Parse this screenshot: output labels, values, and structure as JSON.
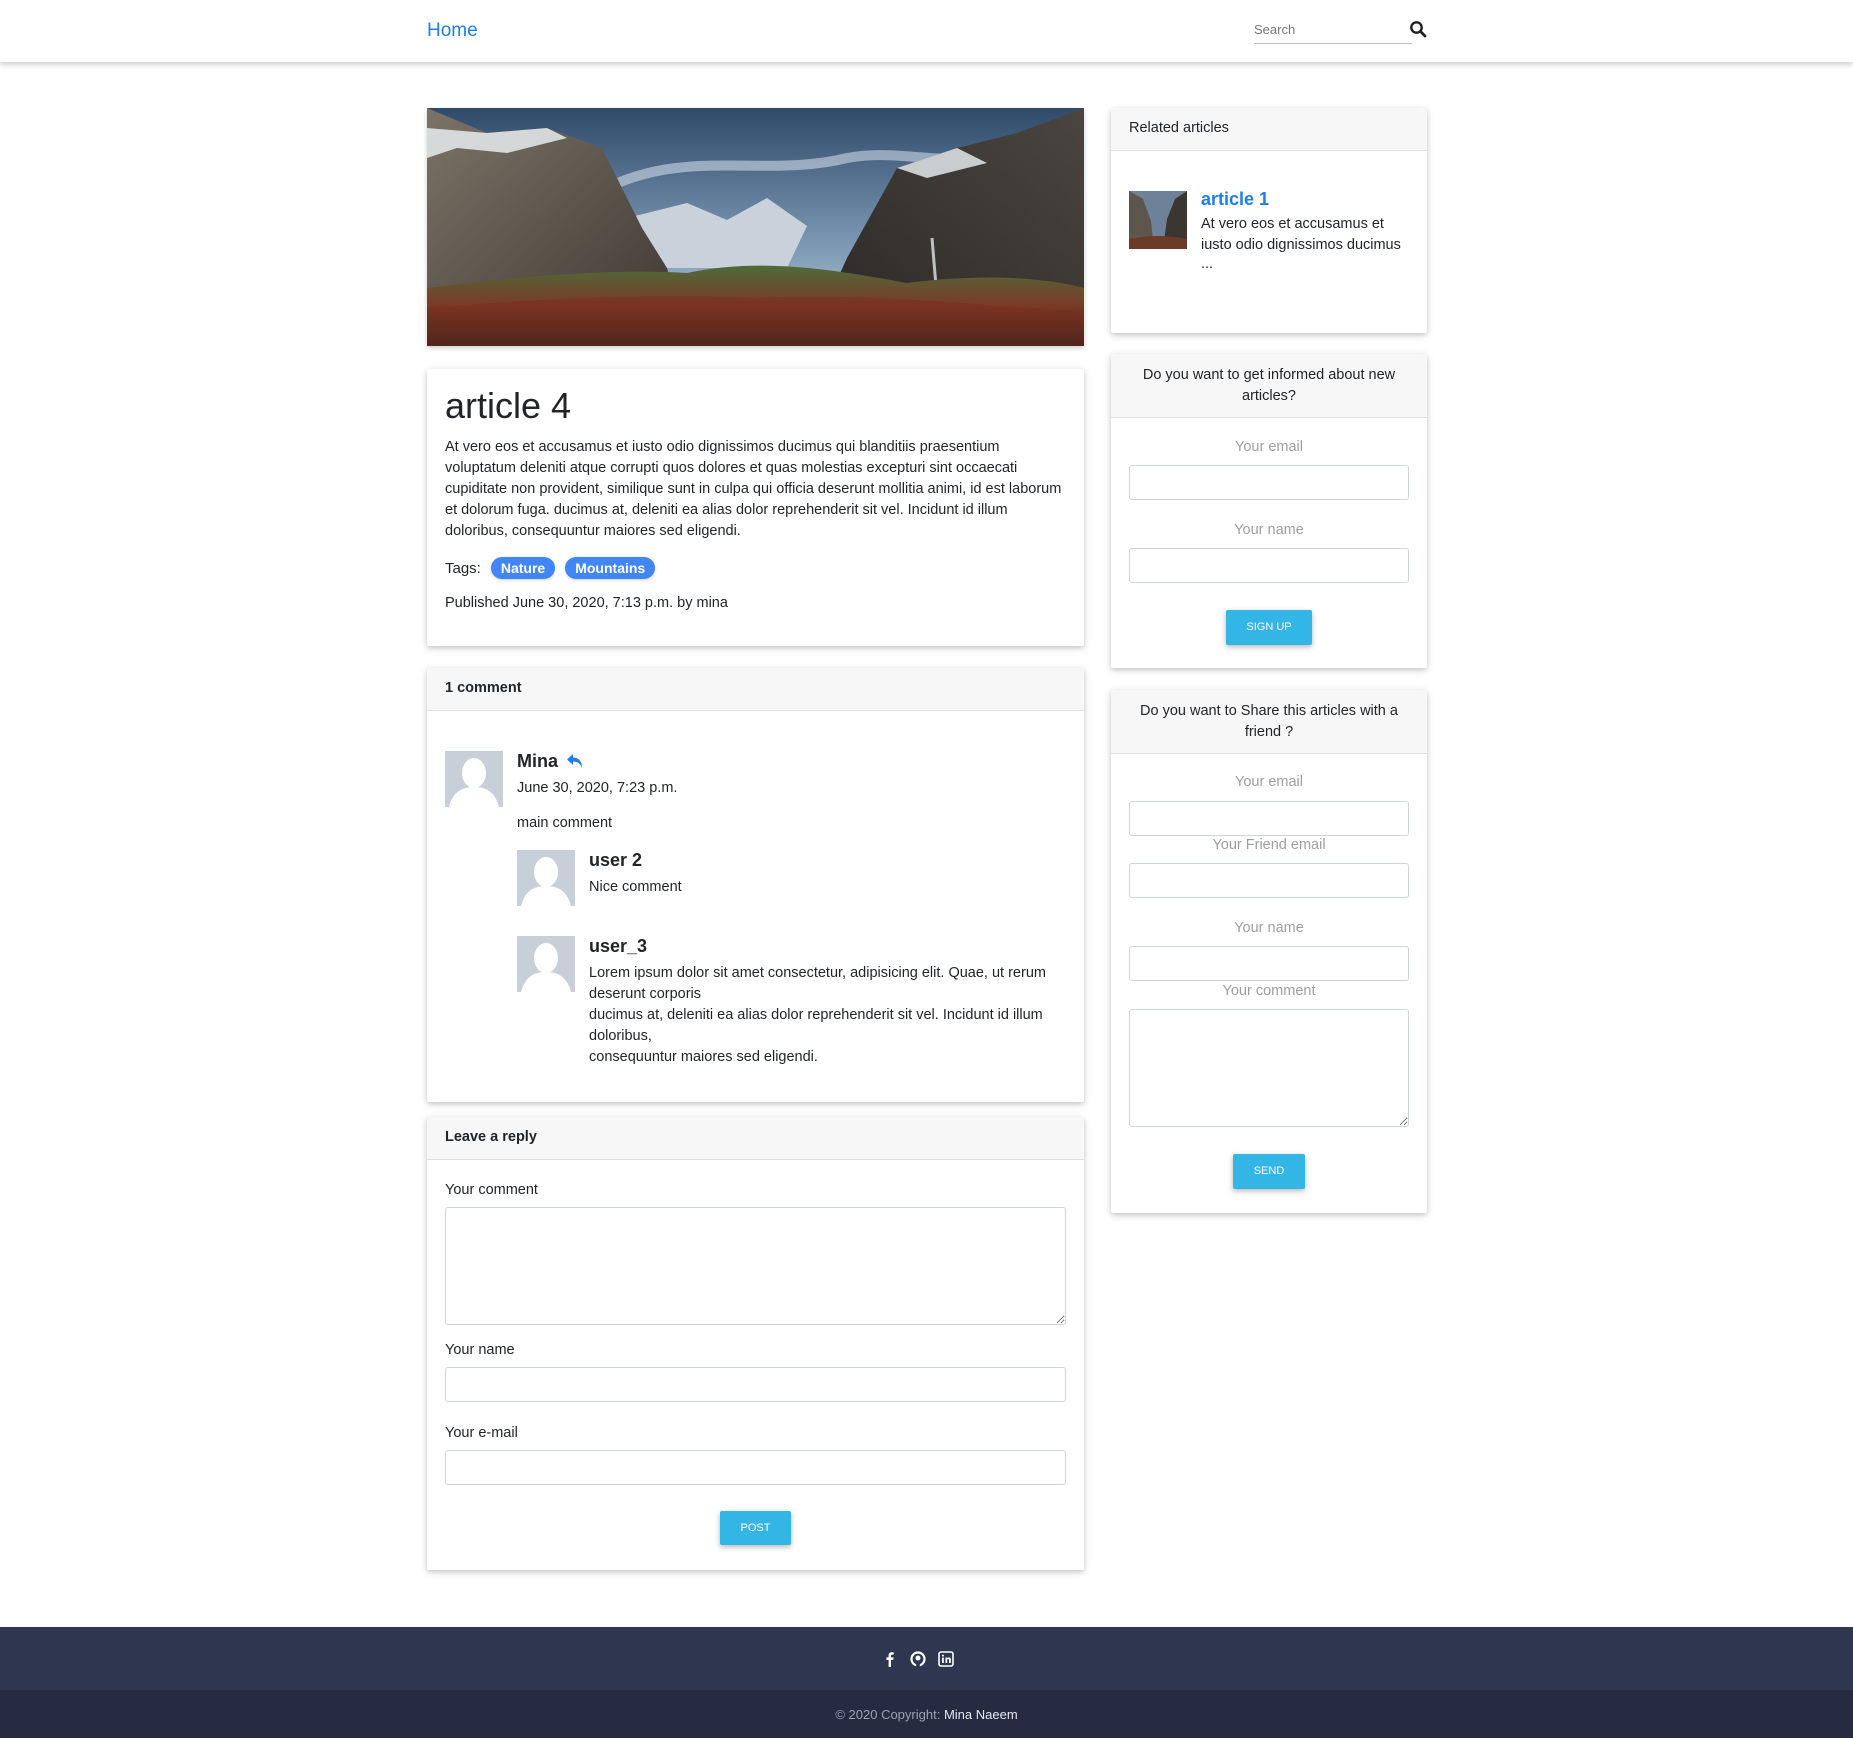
{
  "navbar": {
    "home_label": "Home",
    "search_placeholder": "Search"
  },
  "article": {
    "title": "article 4",
    "body": "At vero eos et accusamus et iusto odio dignissimos ducimus qui blanditiis praesentium voluptatum deleniti atque corrupti quos dolores et quas molestias excepturi sint occaecati cupiditate non provident, similique sunt in culpa qui officia deserunt mollitia animi, id est laborum et dolorum fuga. ducimus at, deleniti ea alias dolor reprehenderit sit vel. Incidunt id illum doloribus, consequuntur maiores sed eligendi.",
    "tags_label": "Tags:",
    "tags": [
      "Nature",
      "Mountains"
    ],
    "published": "Published June 30, 2020, 7:13 p.m. by mina"
  },
  "comments": {
    "header": "1 comment",
    "main": {
      "author": "Mina",
      "date": "June 30, 2020, 7:23 p.m.",
      "text": "main comment"
    },
    "replies": [
      {
        "author": "user 2",
        "text": "Nice comment"
      },
      {
        "author": "user_3",
        "lines": [
          "Lorem ipsum dolor sit amet consectetur, adipisicing elit. Quae, ut rerum deserunt corporis",
          "ducimus at, deleniti ea alias dolor reprehenderit sit vel. Incidunt id illum doloribus,",
          "consequuntur maiores sed eligendi."
        ]
      }
    ]
  },
  "reply_form": {
    "header": "Leave a reply",
    "comment_label": "Your comment",
    "name_label": "Your name",
    "email_label": "Your e-mail",
    "submit": "POST"
  },
  "related": {
    "header": "Related articles",
    "items": [
      {
        "title": "article 1",
        "excerpt": "At vero eos et accusamus et iusto odio dignissimos ducimus",
        "ellipsis": "..."
      }
    ]
  },
  "newsletter": {
    "header": "Do you want to get informed about new articles?",
    "email_label": "Your email",
    "name_label": "Your name",
    "submit": "SIGN UP"
  },
  "share": {
    "header": "Do you want to Share this articles with a friend ?",
    "email_label": "Your email",
    "friend_email_label": "Your Friend email",
    "name_label": "Your name",
    "comment_label": "Your comment",
    "submit": "SEND"
  },
  "footer": {
    "copyright_prefix": "© 2020 Copyright:",
    "owner": "Mina Naeem",
    "icons": [
      "facebook-icon",
      "github-icon",
      "linkedin-icon"
    ]
  },
  "colors": {
    "accent": "#1f7ee6",
    "tag": "#4285f4",
    "button": "#33b5e5",
    "footer_top": "#2e3650",
    "footer_bottom": "#252b41"
  }
}
